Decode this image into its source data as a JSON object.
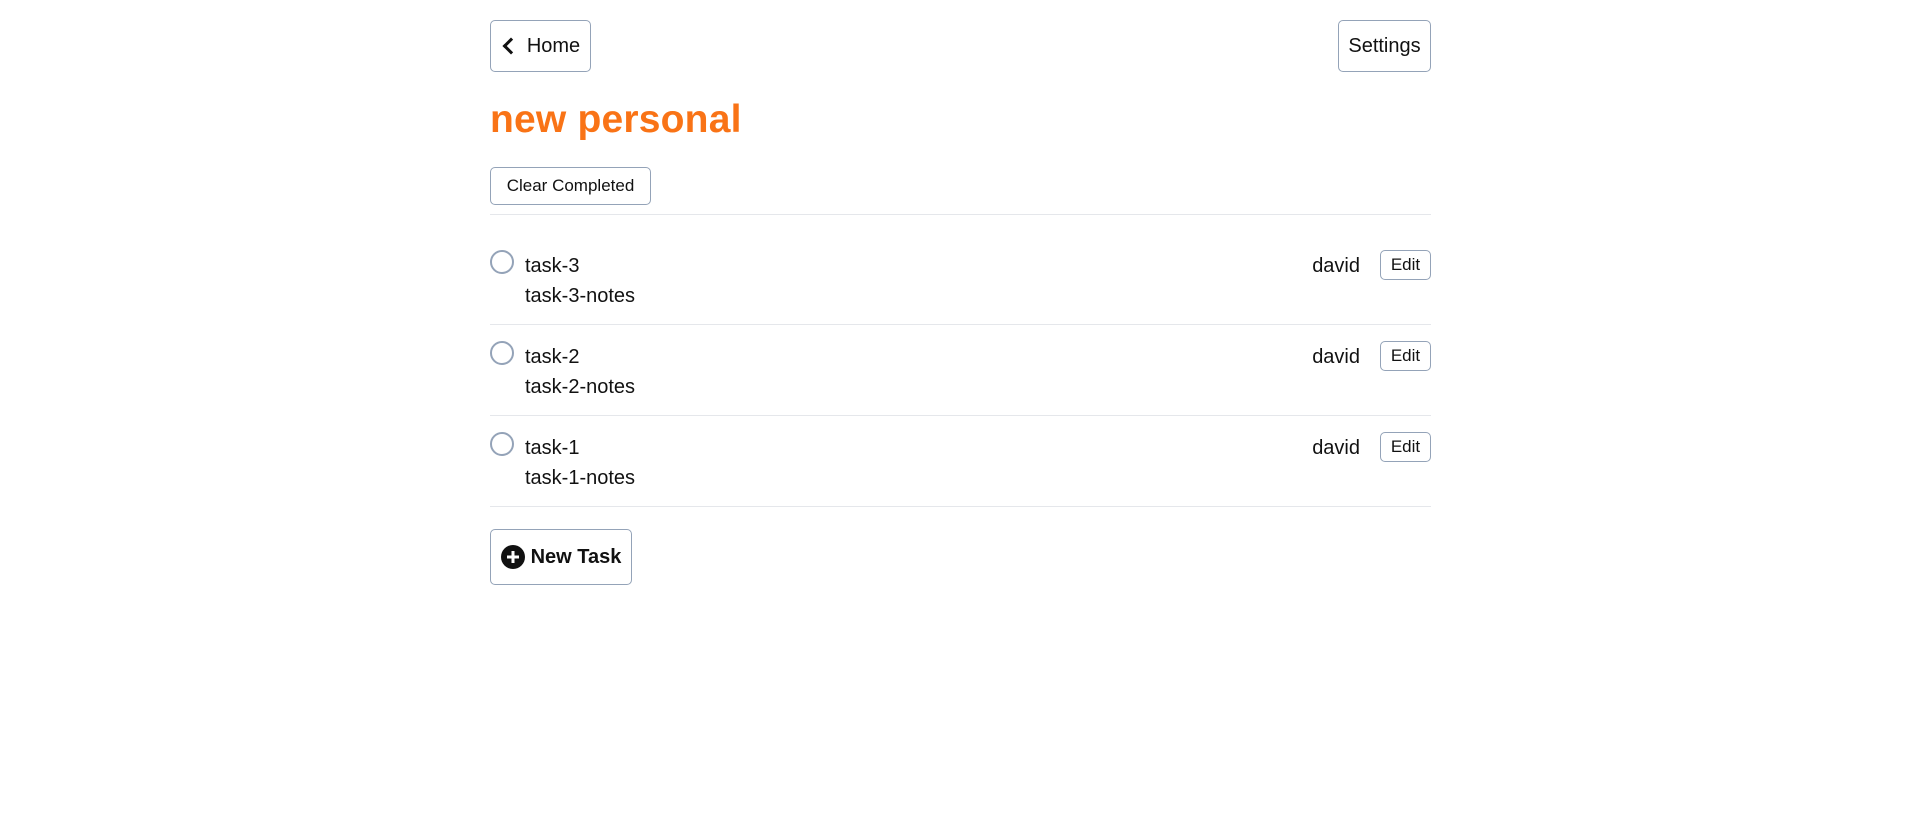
{
  "header": {
    "home_label": "Home",
    "settings_label": "Settings"
  },
  "list": {
    "title": "new personal",
    "clear_completed_label": "Clear Completed",
    "new_task_label": "New Task"
  },
  "tasks": [
    {
      "name": "task-3",
      "notes": "task-3-notes",
      "owner": "david",
      "edit_label": "Edit",
      "completed": false
    },
    {
      "name": "task-2",
      "notes": "task-2-notes",
      "owner": "david",
      "edit_label": "Edit",
      "completed": false
    },
    {
      "name": "task-1",
      "notes": "task-1-notes",
      "owner": "david",
      "edit_label": "Edit",
      "completed": false
    }
  ],
  "colors": {
    "title": "#f97316",
    "border": "#94a3b8",
    "divider": "#e5e7eb"
  },
  "icons": {
    "home": "chevron-left-icon",
    "new_task": "plus-circle-icon",
    "task_status": "circle-icon"
  }
}
